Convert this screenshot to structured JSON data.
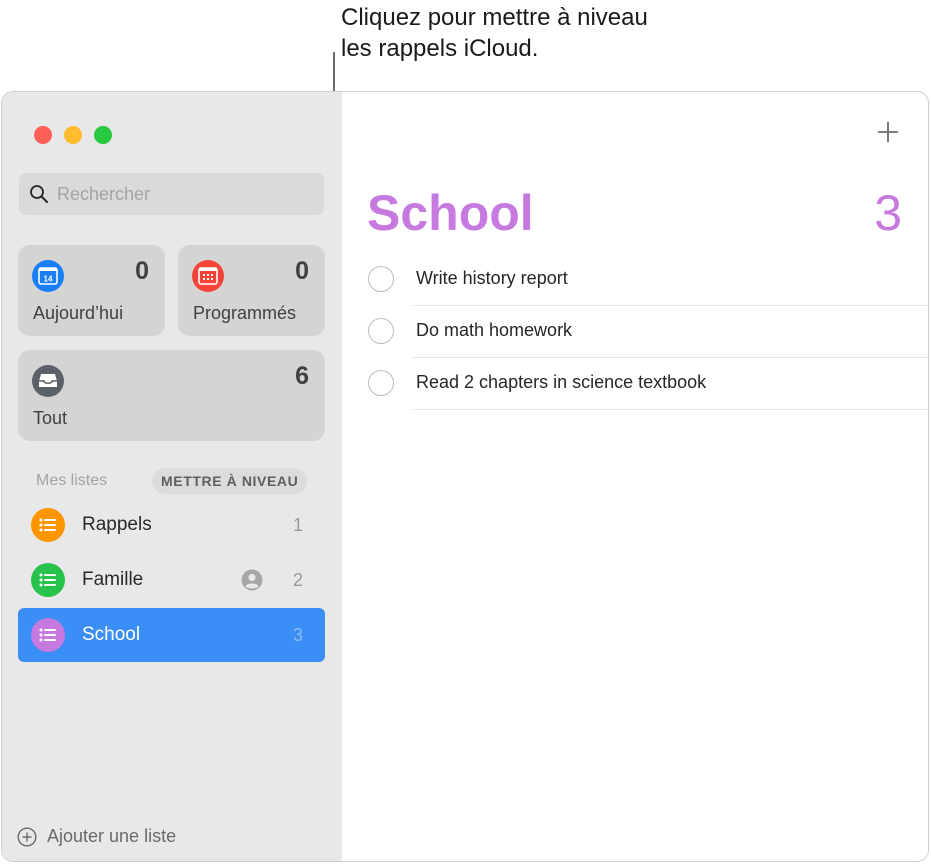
{
  "callout": {
    "text_line1": "Cliquez pour mettre à niveau",
    "text_line2": "les rappels iCloud."
  },
  "window_controls": [
    "close",
    "minimize",
    "zoom"
  ],
  "search": {
    "placeholder": "Rechercher",
    "value": "",
    "icon": "search-icon"
  },
  "smart_lists": {
    "today": {
      "label": "Aujourd’hui",
      "count": "0",
      "icon": "calendar-today-icon",
      "icon_text": "14",
      "color": "#1a7ef7"
    },
    "scheduled": {
      "label": "Programmés",
      "count": "0",
      "icon": "calendar-grid-icon",
      "color": "#f6433a"
    },
    "all": {
      "label": "Tout",
      "count": "6",
      "icon": "tray-icon",
      "color": "#5c6068"
    }
  },
  "my_lists": {
    "heading": "Mes listes",
    "upgrade_label": "METTRE À NIVEAU",
    "items": [
      {
        "name": "Rappels",
        "count": "1",
        "color": "#ff9500",
        "shared": false,
        "selected": false
      },
      {
        "name": "Famille",
        "count": "2",
        "color": "#27c24c",
        "shared": true,
        "selected": false
      },
      {
        "name": "School",
        "count": "3",
        "color": "#c679de",
        "shared": false,
        "selected": true
      }
    ]
  },
  "add_list_label": "Ajouter une liste",
  "main": {
    "title": "School",
    "count": "3",
    "accent": "#c679de",
    "tasks": [
      {
        "title": "Write history report",
        "completed": false
      },
      {
        "title": "Do math homework",
        "completed": false
      },
      {
        "title": "Read 2 chapters in science textbook",
        "completed": false
      }
    ]
  }
}
